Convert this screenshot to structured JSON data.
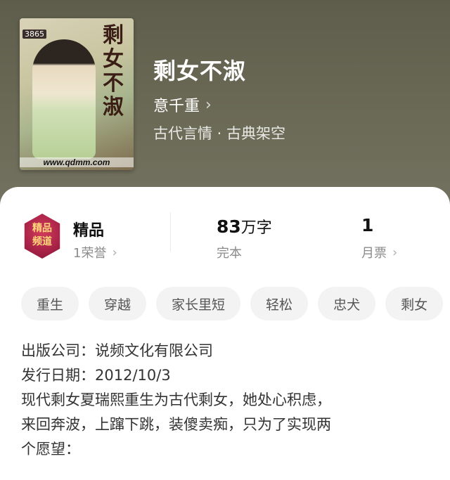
{
  "book": {
    "title": "剩女不淑",
    "author": "意千重",
    "genre": "古代言情 · 古典架空",
    "cover": {
      "vertical_title": "剩女不淑",
      "badge": "3865",
      "url": "www.qdmm.com"
    }
  },
  "stats": {
    "quality_label": "精品",
    "honor": "1荣誉",
    "medal_text": "精品频道",
    "word_count_value": "83",
    "word_count_unit": "万字",
    "status": "完本",
    "monthly_votes": "1",
    "monthly_votes_label": "月票"
  },
  "tags": [
    "重生",
    "穿越",
    "家长里短",
    "轻松",
    "忠犬",
    "剩女"
  ],
  "description": {
    "publisher": "出版公司：说频文化有限公司",
    "release_date": "发行日期：2012/10/3",
    "line1": "现代剩女夏瑞熙重生为古代剩女，她处心积虑，",
    "line2": "来回奔波，上蹿下跳，装傻卖痴，只为了实现两",
    "line3": "个愿望："
  },
  "icons": {
    "chevron": "chevron-right-icon",
    "medal": "quality-medal-icon"
  },
  "colors": {
    "hero_bg": "#62614f",
    "tag_bg": "#f3f3f3",
    "medal": "#a52146"
  }
}
